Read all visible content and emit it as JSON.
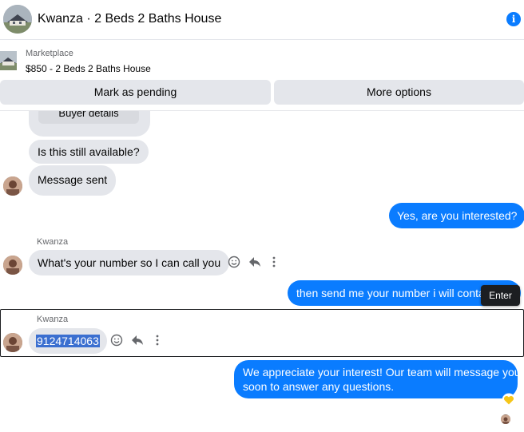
{
  "header": {
    "title": "Kwanza · 2 Beds 2 Baths House",
    "info_icon": "info-icon",
    "info_glyph": "i"
  },
  "listing": {
    "source": "Marketplace",
    "price_title": "$850 - 2 Beds 2 Baths House"
  },
  "actions": {
    "mark_pending": "Mark as pending",
    "more_options": "More options"
  },
  "messages": {
    "buyer_details": "Buyer details",
    "still_available": "Is this still available?",
    "message_sent": "Message sent",
    "reply_interested": "Yes, are you interested?",
    "sender_1": "Kwanza",
    "number_request": "What's your number so I can call you",
    "reply_send_number": "then send me your number i will contact",
    "sender_2": "Kwanza",
    "phone_number": "9124714063",
    "reply_appreciate_line1": "We appreciate your interest! Our team will message you",
    "reply_appreciate_line2": "soon to answer any questions."
  },
  "tooltip": {
    "enter": "Enter"
  },
  "colors": {
    "accent_blue": "#0a7cff",
    "incoming_bubble": "#e4e6eb",
    "selection": "#3b6fd0"
  }
}
